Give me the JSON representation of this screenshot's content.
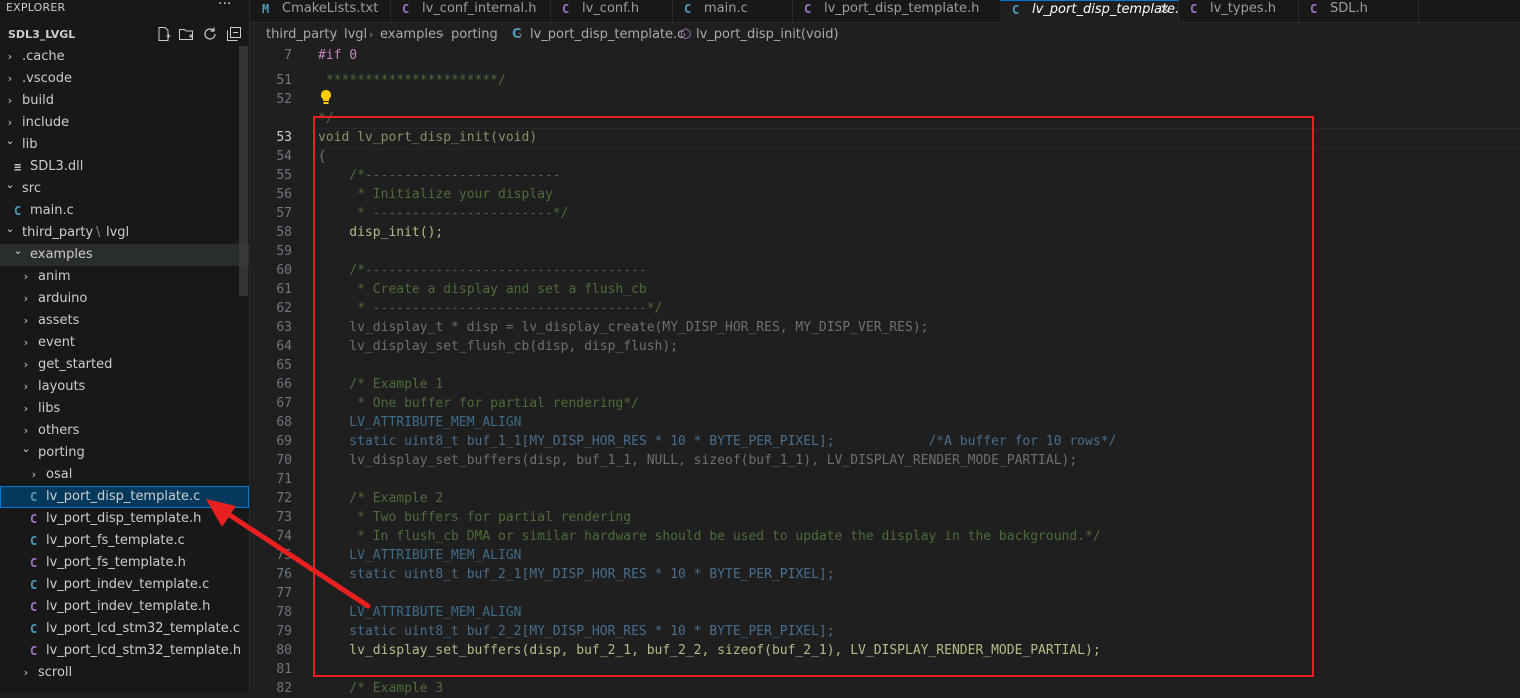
{
  "sidebar": {
    "title": "EXPLORER",
    "more": "···",
    "workspace": "SDL3_LVGL",
    "actions": [
      "new-file-icon",
      "new-folder-icon",
      "refresh-icon",
      "collapse-all-icon"
    ],
    "tree": [
      {
        "label": ".cache",
        "chev": "›"
      },
      {
        "label": ".vscode",
        "chev": "›"
      },
      {
        "label": "build",
        "chev": "›"
      },
      {
        "label": "include",
        "chev": "›"
      },
      {
        "label": "lib",
        "chev": "⌄"
      },
      {
        "label": "SDL3.dll",
        "icon": "≡"
      },
      {
        "label": "src",
        "chev": "⌄"
      },
      {
        "label": "main.c",
        "icon": "C"
      },
      {
        "label": "third_party",
        "sep": "\\",
        "label2": "lvgl",
        "chev": "⌄"
      },
      {
        "label": "examples",
        "chev": "⌄"
      },
      {
        "label": "anim",
        "chev": "›"
      },
      {
        "label": "arduino",
        "chev": "›"
      },
      {
        "label": "assets",
        "chev": "›"
      },
      {
        "label": "event",
        "chev": "›"
      },
      {
        "label": "get_started",
        "chev": "›"
      },
      {
        "label": "layouts",
        "chev": "›"
      },
      {
        "label": "libs",
        "chev": "›"
      },
      {
        "label": "others",
        "chev": "›"
      },
      {
        "label": "porting",
        "chev": "⌄"
      },
      {
        "label": "osal",
        "chev": "›"
      },
      {
        "label": "lv_port_disp_template.c",
        "icon": "C"
      },
      {
        "label": "lv_port_disp_template.h",
        "icon": "C"
      },
      {
        "label": "lv_port_fs_template.c",
        "icon": "C"
      },
      {
        "label": "lv_port_fs_template.h",
        "icon": "C"
      },
      {
        "label": "lv_port_indev_template.c",
        "icon": "C"
      },
      {
        "label": "lv_port_indev_template.h",
        "icon": "C"
      },
      {
        "label": "lv_port_lcd_stm32_template.c",
        "icon": "C"
      },
      {
        "label": "lv_port_lcd_stm32_template.h",
        "icon": "C"
      },
      {
        "label": "scroll",
        "chev": "›"
      }
    ]
  },
  "tabs": [
    {
      "icon": "M",
      "label": "CmakeLists.txt"
    },
    {
      "icon": "C",
      "label": "lv_conf_internal.h"
    },
    {
      "icon": "C",
      "label": "lv_conf.h"
    },
    {
      "icon": "C",
      "label": "main.c"
    },
    {
      "icon": "C",
      "label": "lv_port_disp_template.h"
    },
    {
      "icon": "C",
      "label": "lv_port_disp_template.c",
      "close": "×"
    },
    {
      "icon": "C",
      "label": "lv_types.h"
    },
    {
      "icon": "C",
      "label": "SDL.h"
    }
  ],
  "breadcrumb": {
    "items": [
      "third_party",
      "lvgl",
      "examples",
      "porting",
      "lv_port_disp_template.c",
      "lv_port_disp_init(void)"
    ],
    "sep": "›",
    "file_icon": "C"
  },
  "sticky": {
    "line": "7",
    "code": "#if 0"
  },
  "editor": {
    "lines": [
      {
        "n": "51",
        "code": " **********************/"
      },
      {
        "n": "52",
        "code": ""
      },
      {
        "n": "",
        "code": "*/"
      },
      {
        "n": "53",
        "code": "void lv_port_disp_init(void)"
      },
      {
        "n": "54",
        "code": "{"
      },
      {
        "n": "55",
        "code": "    /*-------------------------"
      },
      {
        "n": "56",
        "code": "     * Initialize your display"
      },
      {
        "n": "57",
        "code": "     * -----------------------*/"
      },
      {
        "n": "58",
        "code": "    disp_init();"
      },
      {
        "n": "59",
        "code": ""
      },
      {
        "n": "60",
        "code": "    /*------------------------------------"
      },
      {
        "n": "61",
        "code": "     * Create a display and set a flush_cb"
      },
      {
        "n": "62",
        "code": "     * -----------------------------------*/"
      },
      {
        "n": "63",
        "code": "    lv_display_t * disp = lv_display_create(MY_DISP_HOR_RES, MY_DISP_VER_RES);"
      },
      {
        "n": "64",
        "code": "    lv_display_set_flush_cb(disp, disp_flush);"
      },
      {
        "n": "65",
        "code": ""
      },
      {
        "n": "66",
        "code": "    /* Example 1"
      },
      {
        "n": "67",
        "code": "     * One buffer for partial rendering*/"
      },
      {
        "n": "68",
        "code": "    LV_ATTRIBUTE_MEM_ALIGN"
      },
      {
        "n": "69",
        "code": "    static uint8_t buf_1_1[MY_DISP_HOR_RES * 10 * BYTE_PER_PIXEL];            /*A buffer for 10 rows*/"
      },
      {
        "n": "70",
        "code": "    lv_display_set_buffers(disp, buf_1_1, NULL, sizeof(buf_1_1), LV_DISPLAY_RENDER_MODE_PARTIAL);"
      },
      {
        "n": "71",
        "code": ""
      },
      {
        "n": "72",
        "code": "    /* Example 2"
      },
      {
        "n": "73",
        "code": "     * Two buffers for partial rendering"
      },
      {
        "n": "74",
        "code": "     * In flush_cb DMA or similar hardware should be used to update the display in the background.*/"
      },
      {
        "n": "75",
        "code": "    LV_ATTRIBUTE_MEM_ALIGN"
      },
      {
        "n": "76",
        "code": "    static uint8_t buf_2_1[MY_DISP_HOR_RES * 10 * BYTE_PER_PIXEL];"
      },
      {
        "n": "77",
        "code": ""
      },
      {
        "n": "78",
        "code": "    LV_ATTRIBUTE_MEM_ALIGN"
      },
      {
        "n": "79",
        "code": "    static uint8_t buf_2_2[MY_DISP_HOR_RES * 10 * BYTE_PER_PIXEL];"
      },
      {
        "n": "80",
        "code": "    lv_display_set_buffers(disp, buf_2_1, buf_2_2, sizeof(buf_2_1), LV_DISPLAY_RENDER_MODE_PARTIAL);"
      },
      {
        "n": "81",
        "code": ""
      },
      {
        "n": "82",
        "code": "    /* Example 3"
      }
    ]
  },
  "colors": {
    "accent": "#0078d4",
    "annotation": "#e8201f",
    "c_icon": "#519aba",
    "h_icon": "#a074c4",
    "m_icon": "#519aba"
  }
}
